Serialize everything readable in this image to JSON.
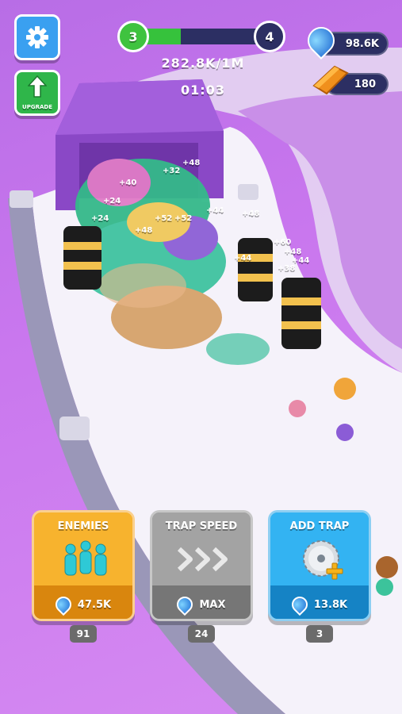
{
  "colors": {
    "settings": "#3aa0f0",
    "upgrade": "#2fb64a",
    "enemies": "#f4a11c",
    "trap_speed": "#8f8f8f",
    "add_trap": "#1d9fe5",
    "progress_fill": "#36c23c",
    "level_current": "#3fc33f",
    "level_next": "#2c2f63"
  },
  "hud": {
    "settings_icon": "gear-icon",
    "upgrade_label": "UPGRADE",
    "level_current": "3",
    "level_next": "4",
    "level_progress": 0.35,
    "progress_text": "282.8K/1M",
    "timer": "01:03",
    "currency_water": "98.6K",
    "currency_gold": "180"
  },
  "world": {
    "bonus_labels": [
      "+48",
      "+44",
      "+52",
      "+60",
      "+48",
      "+44",
      "+38",
      "+24",
      "+48",
      "+40",
      "+32",
      "+44",
      "+48",
      "+24",
      "+52"
    ]
  },
  "cards": [
    {
      "title": "ENEMIES",
      "icon": "people-icon",
      "cost": "47.5K",
      "count": "91"
    },
    {
      "title": "TRAP SPEED",
      "icon": "chevrons-right-icon",
      "cost": "MAX",
      "count": "24"
    },
    {
      "title": "ADD TRAP",
      "icon": "saw-blade-plus-icon",
      "cost": "13.8K",
      "count": "3"
    }
  ]
}
